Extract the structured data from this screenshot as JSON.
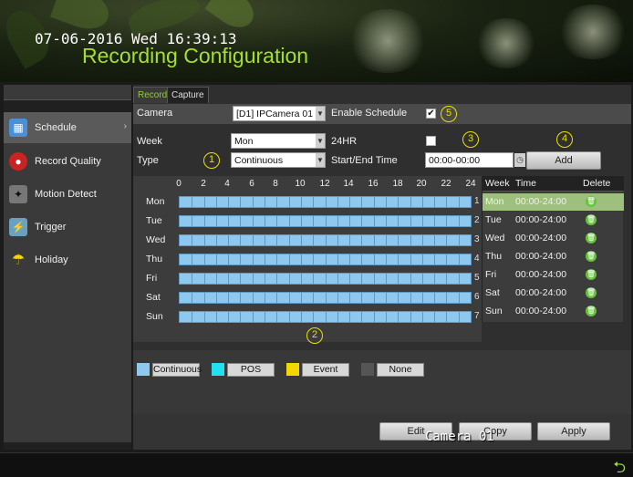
{
  "header": {
    "datetime": "07-06-2016 Wed 16:39:13",
    "title": "Recording Configuration"
  },
  "sidebar": {
    "items": [
      {
        "label": "Schedule",
        "icon": "calendar-icon",
        "active": true
      },
      {
        "label": "Record Quality",
        "icon": "record-icon",
        "active": false
      },
      {
        "label": "Motion Detect",
        "icon": "motion-icon",
        "active": false
      },
      {
        "label": "Trigger",
        "icon": "trigger-icon",
        "active": false
      },
      {
        "label": "Holiday",
        "icon": "holiday-icon",
        "active": false
      }
    ]
  },
  "tabs": [
    {
      "label": "Record",
      "active": true
    },
    {
      "label": "Capture",
      "active": false
    }
  ],
  "form": {
    "camera_label": "Camera",
    "camera_value": "[D1] IPCamera 01",
    "enable_schedule_label": "Enable Schedule",
    "enable_schedule_checked": true,
    "week_label": "Week",
    "week_value": "Mon",
    "type_label": "Type",
    "type_value": "Continuous",
    "hr24_label": "24HR",
    "hr24_checked": false,
    "start_end_label": "Start/End Time",
    "start_end_value": "00:00-00:00",
    "add_label": "Add"
  },
  "badges": [
    "1",
    "2",
    "3",
    "4",
    "5"
  ],
  "grid": {
    "hours": [
      "0",
      "2",
      "4",
      "6",
      "8",
      "10",
      "12",
      "14",
      "16",
      "18",
      "20",
      "22",
      "24"
    ],
    "days": [
      "Mon",
      "Tue",
      "Wed",
      "Thu",
      "Fri",
      "Sat",
      "Sun"
    ],
    "row_numbers": [
      "1",
      "2",
      "3",
      "4",
      "5",
      "6",
      "7"
    ]
  },
  "week_table": {
    "headers": {
      "week": "Week",
      "time": "Time",
      "delete": "Delete"
    },
    "rows": [
      {
        "week": "Mon",
        "time": "00:00-24:00"
      },
      {
        "week": "Tue",
        "time": "00:00-24:00"
      },
      {
        "week": "Wed",
        "time": "00:00-24:00"
      },
      {
        "week": "Thu",
        "time": "00:00-24:00"
      },
      {
        "week": "Fri",
        "time": "00:00-24:00"
      },
      {
        "week": "Sat",
        "time": "00:00-24:00"
      },
      {
        "week": "Sun",
        "time": "00:00-24:00"
      }
    ]
  },
  "legend": [
    {
      "label": "Continuous",
      "color": "#8ec8ee"
    },
    {
      "label": "POS",
      "color": "#22e0f0"
    },
    {
      "label": "Event",
      "color": "#f4d600"
    },
    {
      "label": "None",
      "color": "#555555"
    }
  ],
  "footer": {
    "edit_label": "Edit",
    "copy_label": "Copy",
    "apply_label": "Apply"
  },
  "camera_overlay": "Camera 01",
  "colors": {
    "title": "#a4e02a",
    "accent": "#8cd02a",
    "schedule_fill": "#8ec8ee",
    "selected_row": "#9dc17c",
    "badge": "#e8e000"
  }
}
